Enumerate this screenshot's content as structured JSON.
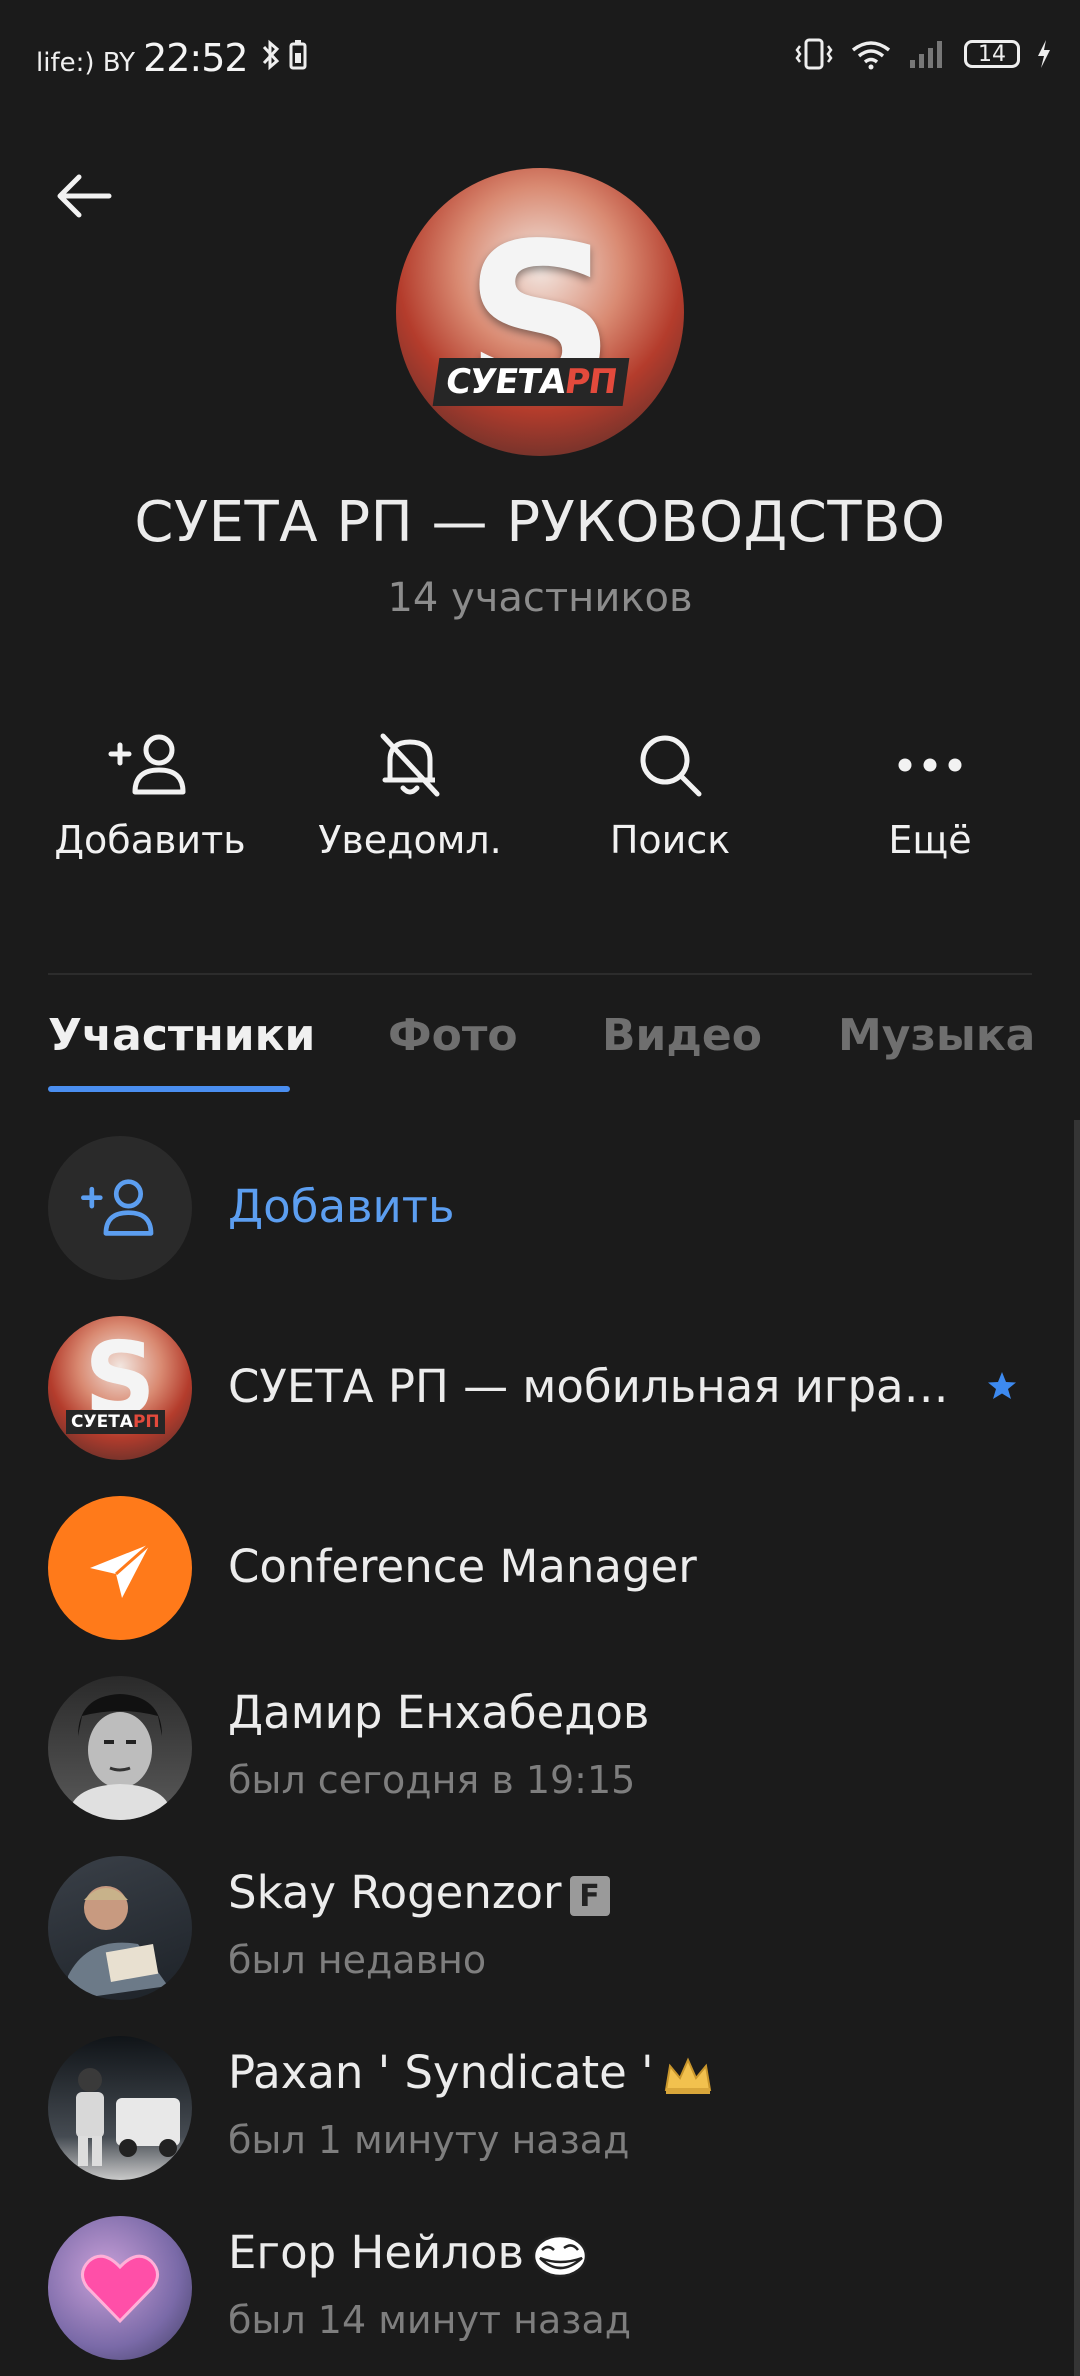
{
  "status_bar": {
    "carrier": "life:) BY",
    "time": "22:52",
    "battery": "14"
  },
  "header": {
    "title": "СУЕТА РП — РУКОВОДСТВО",
    "subtitle": "14 участников",
    "avatar_text_white": "СУЕТА",
    "avatar_text_red": "РП"
  },
  "actions": [
    {
      "label": "Добавить",
      "icon": "add-user-icon"
    },
    {
      "label": "Уведомл.",
      "icon": "bell-off-icon"
    },
    {
      "label": "Поиск",
      "icon": "search-icon"
    },
    {
      "label": "Ещё",
      "icon": "more-icon"
    }
  ],
  "tabs": [
    {
      "label": "Участники",
      "active": true
    },
    {
      "label": "Фото",
      "active": false
    },
    {
      "label": "Видео",
      "active": false
    },
    {
      "label": "Музыка",
      "active": false
    }
  ],
  "members": {
    "add_label": "Добавить",
    "items": [
      {
        "name": "СУЕТА РП — мобильная игра…",
        "status": "",
        "badge": "star-icon"
      },
      {
        "name": "Conference Manager",
        "status": ""
      },
      {
        "name": "Дамир Енхабедов",
        "status": "был сегодня в 19:15"
      },
      {
        "name": "Skay Rogenzor",
        "status": "был недавно",
        "badge": "f-badge"
      },
      {
        "name": "Paxan ' Syndicate '",
        "status": "был 1 минуту назад",
        "badge": "crown-icon"
      },
      {
        "name": "Егор Нейлов",
        "status": "был 14 минут назад",
        "badge": "troll-face-icon"
      }
    ]
  },
  "colors": {
    "background": "#1b1b1b",
    "accent": "#4a8ef0",
    "link": "#5c9ef0",
    "conference_orange": "#ff7a1a"
  }
}
